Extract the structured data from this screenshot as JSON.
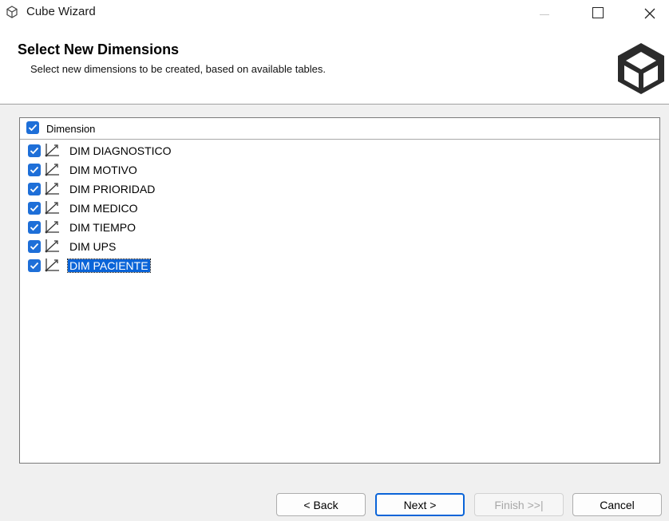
{
  "window": {
    "title": "Cube Wizard"
  },
  "header": {
    "title": "Select New Dimensions",
    "subtitle": "Select new dimensions to be created, based on available tables."
  },
  "tree": {
    "column_header": "Dimension",
    "header_checked": true,
    "items": [
      {
        "label": "DIM DIAGNOSTICO",
        "checked": true,
        "selected": false
      },
      {
        "label": "DIM MOTIVO",
        "checked": true,
        "selected": false
      },
      {
        "label": "DIM PRIORIDAD",
        "checked": true,
        "selected": false
      },
      {
        "label": "DIM MEDICO",
        "checked": true,
        "selected": false
      },
      {
        "label": "DIM TIEMPO",
        "checked": true,
        "selected": false
      },
      {
        "label": "DIM UPS",
        "checked": true,
        "selected": false
      },
      {
        "label": "DIM PACIENTE",
        "checked": true,
        "selected": true
      }
    ]
  },
  "buttons": {
    "back": "< Back",
    "next": "Next >",
    "finish": "Finish >>|",
    "cancel": "Cancel"
  },
  "colors": {
    "accent": "#0a64d8",
    "checkbox": "#1e6fd8"
  }
}
